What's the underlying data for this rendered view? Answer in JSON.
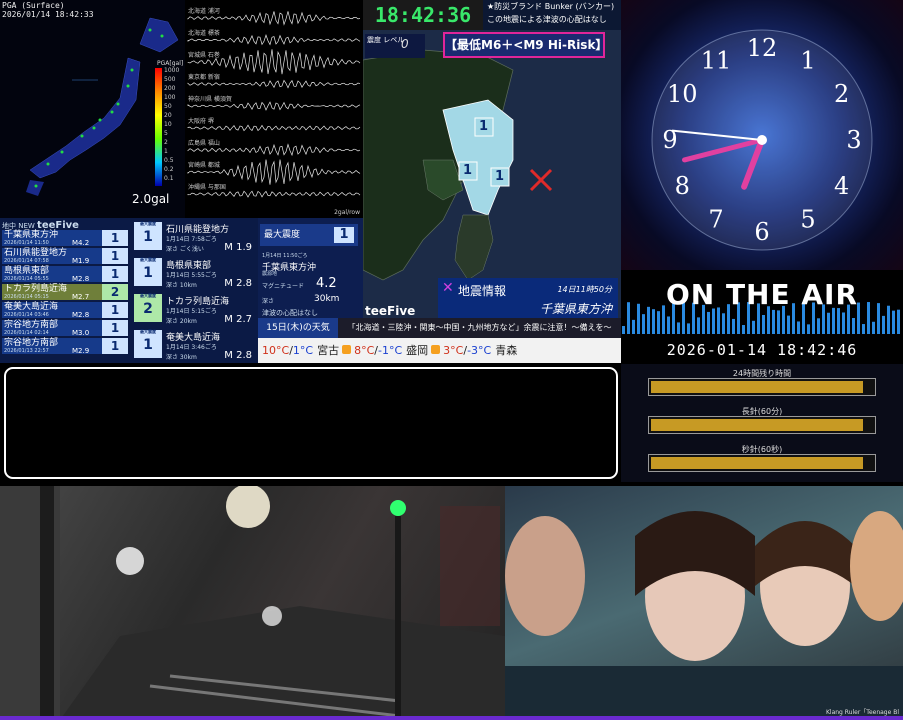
{
  "pga": {
    "title": "PGA (Surface)",
    "timestamp": "2026/01/14 18:42:33",
    "unit_label": "PGA[gal]",
    "scale_ticks": [
      "1000",
      "500",
      "200",
      "100",
      "50",
      "20",
      "10",
      "5",
      "2",
      "1",
      "0.5",
      "0.2",
      "0.1"
    ],
    "max_value": "2.0gal"
  },
  "waveform": {
    "stations": [
      "北海道 浦河",
      "北海道 標茶",
      "宮城県 石巻",
      "東京都 新宿",
      "神奈川県 横須賀",
      "大阪府 堺",
      "広島県 福山",
      "宮崎県 都城",
      "沖縄県 与那国"
    ],
    "footer": "2gal/row"
  },
  "top_clock": {
    "time": "18:42:36"
  },
  "bunker": {
    "title": "★防災ブランド Bunker (バンカー)",
    "message": "この地震による津波の心配はなし"
  },
  "map_panel": {
    "shindo_label": "震度 レベル",
    "shindo_value": "0",
    "risk_banner": "【最低M6＋<M9 Hi-Risk】",
    "intensity_markers": [
      "1",
      "1",
      "1"
    ],
    "eq_info_title": "地震情報",
    "eq_info_date": "14日11時50分",
    "eq_info_region": "千葉県東方沖",
    "logo": "teeFive"
  },
  "eq_list": {
    "header_left": "地中 NEW",
    "header_logo": "teeFive",
    "rows": [
      {
        "name": "千葉県東方沖",
        "time": "2026/01/14 11:50",
        "mag": "M4.2",
        "intensity": "1",
        "highlight": false
      },
      {
        "name": "石川県能登地方",
        "time": "2026/01/14 07:58",
        "mag": "M1.9",
        "intensity": "1",
        "highlight": false
      },
      {
        "name": "島根県東部",
        "time": "2026/01/14 05:55",
        "mag": "M2.8",
        "intensity": "1",
        "highlight": false
      },
      {
        "name": "トカラ列島近海",
        "time": "2026/01/14 05:15",
        "mag": "M2.7",
        "intensity": "2",
        "highlight": true
      },
      {
        "name": "奄美大島近海",
        "time": "2026/01/14 03:46",
        "mag": "M2.8",
        "intensity": "1",
        "highlight": false
      },
      {
        "name": "宗谷地方南部",
        "time": "2026/01/14 02:14",
        "mag": "M3.0",
        "intensity": "1",
        "highlight": false
      },
      {
        "name": "宗谷地方南部",
        "time": "2026/01/13 22:57",
        "mag": "M2.9",
        "intensity": "1",
        "highlight": false
      }
    ]
  },
  "eq_detail": {
    "badge_label": "最大震度",
    "items": [
      {
        "name": "石川県能登地方",
        "time": "1月14日 7:58ごろ",
        "depth": "深さ ごく浅い",
        "mag": "M 1.9",
        "intensity": "1"
      },
      {
        "name": "島根県東部",
        "time": "1月14日 5:55ごろ",
        "depth": "深さ 10km",
        "mag": "M 2.8",
        "intensity": "1"
      },
      {
        "name": "トカラ列島近海",
        "time": "1月14日 5:15ごろ",
        "depth": "深さ 20km",
        "mag": "M 2.7",
        "intensity": "2"
      },
      {
        "name": "奄美大島近海",
        "time": "1月14日 3:46ごろ",
        "depth": "深さ 30km",
        "mag": "M 2.8",
        "intensity": "1"
      }
    ]
  },
  "max_intensity": {
    "header": "最大震度",
    "value": "1",
    "time": "1月14日 11:50ごろ",
    "place": "千葉県東方沖",
    "sub": "震源地",
    "mag_label": "マグニチュード",
    "mag_value": "4.2",
    "depth_label": "深さ",
    "depth_value": "30km",
    "tsunami": "津波の心配はなし"
  },
  "weather": {
    "day": "15日(木)の天気",
    "warning": "「北海道・三陸沖・関東〜中国・九州地方など」余震に注意！〜備えを〜",
    "cities": [
      {
        "name": "",
        "hi": "10°C",
        "lo": "1°C"
      },
      {
        "name": "宮古",
        "hi": "8°C",
        "lo": "-1°C"
      },
      {
        "name": "盛岡",
        "hi": "3°C",
        "lo": "-3°C"
      },
      {
        "name": "青森",
        "hi": "",
        "lo": ""
      }
    ]
  },
  "clock": {
    "numerals": [
      "12",
      "1",
      "2",
      "3",
      "4",
      "5",
      "6",
      "7",
      "8",
      "9",
      "10",
      "11"
    ],
    "hour": 6.7,
    "minute": 42.6,
    "second": 46
  },
  "onair": {
    "text": "ON THE AIR"
  },
  "datetime": {
    "text": "2026-01-14 18:42:46"
  },
  "timers": [
    {
      "label": "24時間残り時間",
      "fill": 0.95
    },
    {
      "label": "長針(60分)",
      "fill": 0.95
    },
    {
      "label": "秒針(60秒)",
      "fill": 0.95
    }
  ],
  "cam2": {
    "credit": "Klang Ruler「Teenage Bl"
  },
  "colors": {
    "accent": "#39e86a",
    "risk_border": "#e0259a",
    "panel_blue": "#163a8a",
    "timer_fill": "#c79a24"
  }
}
